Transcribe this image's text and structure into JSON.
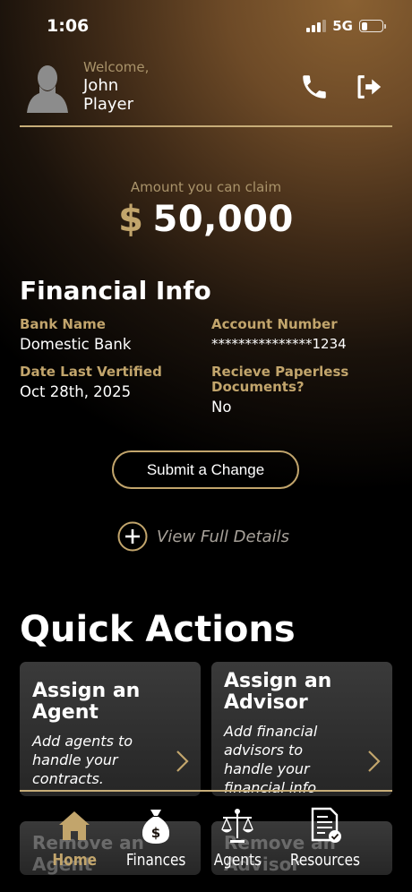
{
  "status_bar": {
    "time": "1:06",
    "network": "5G",
    "battery_level": 0.3
  },
  "header": {
    "welcome": "Welcome,",
    "first_name": "John",
    "last_name": "Player"
  },
  "claim": {
    "label": "Amount you can claim",
    "currency": "$",
    "amount": "50,000"
  },
  "financial_info": {
    "title": "Financial Info",
    "bank_name_label": "Bank Name",
    "bank_name_value": "Domestic Bank",
    "account_number_label": "Account Number",
    "account_number_value": "***************1234",
    "date_verified_label": "Date Last Vertified",
    "date_verified_value": "Oct 28th, 2025",
    "paperless_label_line1": "Recieve Paperless",
    "paperless_label_line2": "Documents?",
    "paperless_value": "No",
    "submit_label": "Submit a Change",
    "view_details_label": "View Full Details"
  },
  "quick_actions": {
    "title": "Quick Actions",
    "cards": [
      {
        "title_line1": "Assign an",
        "title_line2": "Agent",
        "desc_line1": "Add agents to",
        "desc_line2": "handle your",
        "desc_line3": "contracts."
      },
      {
        "title_line1": "Assign an",
        "title_line2": "Advisor",
        "desc_line1": "Add financial",
        "desc_line2": "advisors to",
        "desc_line3": "handle your",
        "desc_line4": "financial info"
      },
      {
        "title": "Remove an Agent"
      },
      {
        "title": "Remove an Advisor"
      }
    ]
  },
  "nav": {
    "items": [
      {
        "label": "Home",
        "icon": "home-icon",
        "active": true
      },
      {
        "label": "Finances",
        "icon": "money-bag-icon",
        "active": false
      },
      {
        "label": "Agents",
        "icon": "scales-icon",
        "active": false
      },
      {
        "label": "Resources",
        "icon": "document-icon",
        "active": false
      }
    ]
  },
  "colors": {
    "accent": "#c2a56c",
    "label_gold": "#a9936a",
    "card_bg": "#333333"
  }
}
